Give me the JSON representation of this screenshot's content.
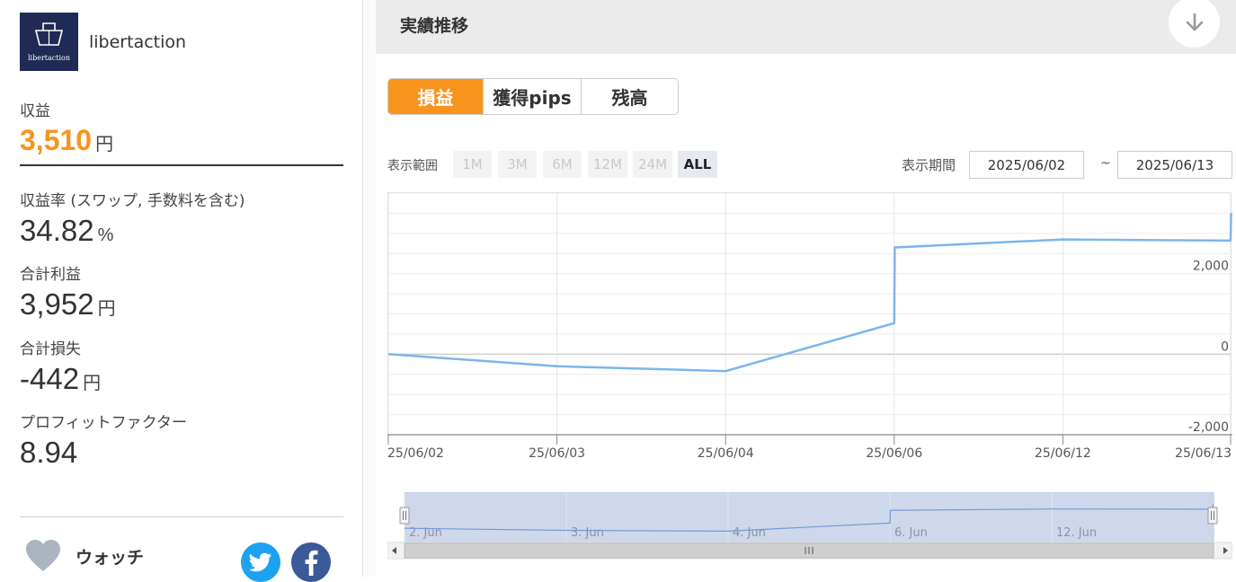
{
  "profile": {
    "username": "libertaction",
    "logo_text": "libertaction"
  },
  "metrics": {
    "revenue_label": "収益",
    "revenue_value": "3,510",
    "revenue_unit": "円",
    "rate_label": "収益率 (スワップ, 手数料を含む)",
    "rate_value": "34.82",
    "rate_unit": "%",
    "total_profit_label": "合計利益",
    "total_profit_value": "3,952",
    "total_profit_unit": "円",
    "total_loss_label": "合計損失",
    "total_loss_value": "-442",
    "total_loss_unit": "円",
    "pf_label": "プロフィットファクター",
    "pf_value": "8.94"
  },
  "watch": {
    "label": "ウォッチ",
    "icon": "heart-icon"
  },
  "social": {
    "twitter_icon": "twitter-icon",
    "facebook_icon": "facebook-icon"
  },
  "section": {
    "title": "実績推移",
    "collapse_icon": "arrow-down-icon"
  },
  "tabs": [
    {
      "label": "損益",
      "active": true
    },
    {
      "label": "獲得pips",
      "active": false
    },
    {
      "label": "残高",
      "active": false
    }
  ],
  "range": {
    "label": "表示範囲",
    "options": [
      {
        "label": "1M",
        "active": false
      },
      {
        "label": "3M",
        "active": false
      },
      {
        "label": "6M",
        "active": false
      },
      {
        "label": "12M",
        "active": false
      },
      {
        "label": "24M",
        "active": false
      },
      {
        "label": "ALL",
        "active": true
      }
    ]
  },
  "period": {
    "label": "表示期間",
    "from": "2025/06/02",
    "separator": "~",
    "to": "2025/06/13"
  },
  "colors": {
    "accent": "#f7941d",
    "line": "#7cb5ec",
    "navigator_fill": "#cfd7ea"
  },
  "chart_data": {
    "type": "line",
    "title": "",
    "xlabel": "",
    "ylabel": "",
    "x_tick_labels": [
      "25/06/02",
      "25/06/03",
      "25/06/04",
      "25/06/06",
      "25/06/12",
      "25/06/13"
    ],
    "y_tick_labels": [
      "2,000",
      "0",
      "-2,000"
    ],
    "ylim": [
      -2000,
      4000
    ],
    "grid": true,
    "series": [
      {
        "points": [
          {
            "x": "2025-06-02",
            "y": 0
          },
          {
            "x": "2025-06-03",
            "y": -300
          },
          {
            "x": "2025-06-04",
            "y": -420
          },
          {
            "x": "2025-06-06 00:00",
            "y": 770
          },
          {
            "x": "2025-06-06 00:01",
            "y": 2650
          },
          {
            "x": "2025-06-12",
            "y": 2850
          },
          {
            "x": "2025-06-13 00:00",
            "y": 2820
          },
          {
            "x": "2025-06-13 00:01",
            "y": 3510
          }
        ]
      }
    ],
    "navigator": {
      "tick_labels": [
        "2. Jun",
        "3. Jun",
        "4. Jun",
        "6. Jun",
        "12. Jun"
      ]
    }
  }
}
